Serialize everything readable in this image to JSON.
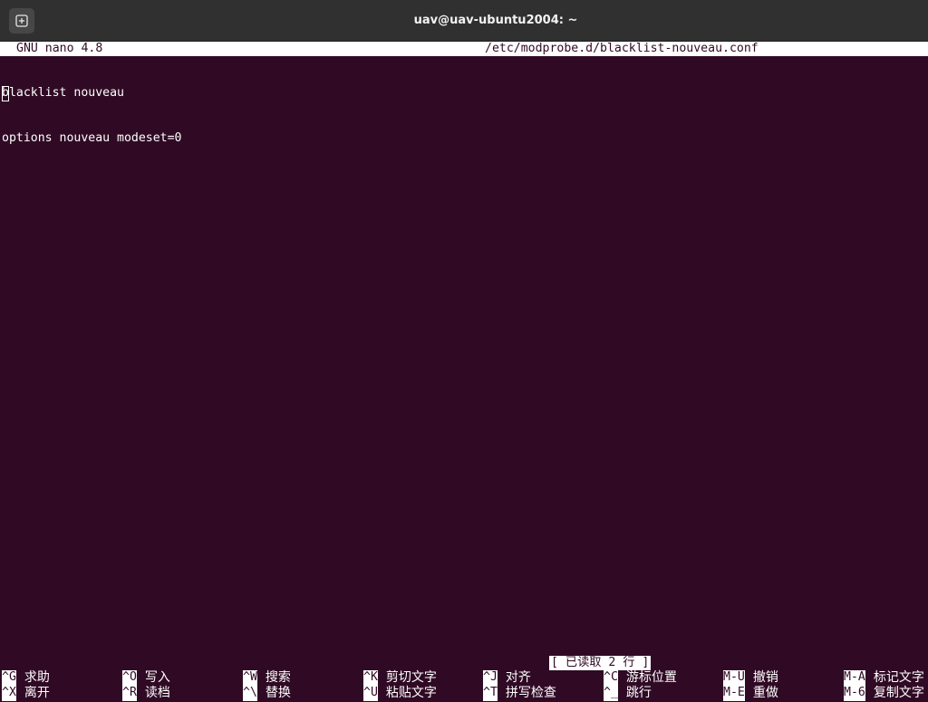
{
  "window": {
    "title": "uav@uav-ubuntu2004: ~",
    "new_tab_icon": "new-tab-icon"
  },
  "nano": {
    "version": "GNU nano 4.8",
    "filename": "/etc/modprobe.d/blacklist-nouveau.conf",
    "lines": [
      {
        "cursor_char": "b",
        "rest": "lacklist nouveau"
      },
      {
        "cursor_char": "",
        "rest": "options nouveau modeset=0"
      }
    ],
    "status": "[ 已读取 2 行 ]",
    "shortcuts_row1": [
      {
        "key": "^G",
        "label": "求助"
      },
      {
        "key": "^O",
        "label": "写入"
      },
      {
        "key": "^W",
        "label": "搜索"
      },
      {
        "key": "^K",
        "label": "剪切文字"
      },
      {
        "key": "^J",
        "label": "对齐"
      },
      {
        "key": "^C",
        "label": "游标位置"
      },
      {
        "key": "M-U",
        "label": "撤销"
      },
      {
        "key": "M-A",
        "label": "标记文字"
      }
    ],
    "shortcuts_row2": [
      {
        "key": "^X",
        "label": "离开"
      },
      {
        "key": "^R",
        "label": "读档"
      },
      {
        "key": "^\\",
        "label": "替换"
      },
      {
        "key": "^U",
        "label": "粘贴文字"
      },
      {
        "key": "^T",
        "label": "拼写检查"
      },
      {
        "key": "^_",
        "label": "跳行"
      },
      {
        "key": "M-E",
        "label": "重做"
      },
      {
        "key": "M-6",
        "label": "复制文字"
      }
    ]
  },
  "colors": {
    "terminal_bg": "#300a24",
    "titlebar_bg": "#303030",
    "text": "#ffffff"
  }
}
